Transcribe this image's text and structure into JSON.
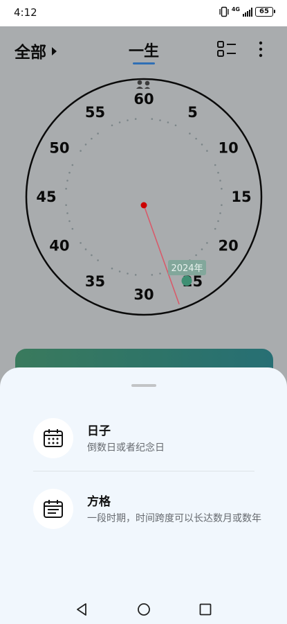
{
  "status_bar": {
    "time": "4:12",
    "network": "4G",
    "battery": "65"
  },
  "header": {
    "filter_label": "全部",
    "center_tab": "一生"
  },
  "clock": {
    "labels": [
      "60",
      "5",
      "10",
      "15",
      "20",
      "25",
      "30",
      "35",
      "40",
      "45",
      "50",
      "55"
    ],
    "current_value": 25,
    "marker_label": "2024年",
    "colors": {
      "hand": "#d85a6a",
      "center_dot": "#cc0000",
      "marker": "#3e8f73"
    }
  },
  "sheet": {
    "options": [
      {
        "title": "日子",
        "desc": "倒数日或者纪念日",
        "icon": "calendar-icon"
      },
      {
        "title": "方格",
        "desc": "一段时期，时间跨度可以长达数月或数年",
        "icon": "calendar-list-icon"
      }
    ]
  },
  "navbar": {
    "back": "back-icon",
    "home": "home-icon",
    "recents": "recents-icon"
  }
}
